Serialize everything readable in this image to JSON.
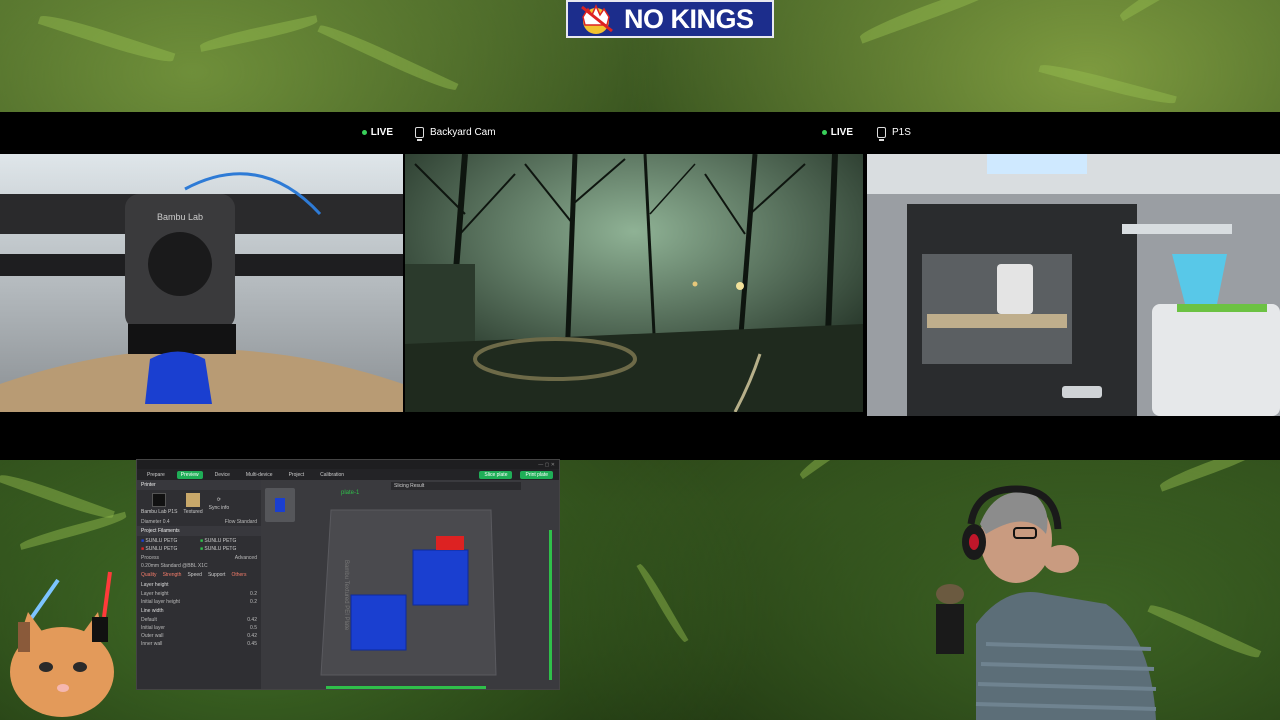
{
  "banner": {
    "text": "NO KINGS"
  },
  "cameras": [
    {
      "name": "",
      "live_label": "LIVE"
    },
    {
      "name": "Backyard Cam",
      "live_label": "LIVE"
    },
    {
      "name": "P1S",
      "live_label": ""
    }
  ],
  "printer_cam": {
    "logo": "Bambu Lab"
  },
  "slicer": {
    "tabs": [
      "Prepare",
      "Preview",
      "Device",
      "Multi-device",
      "Project",
      "Calibration"
    ],
    "active_tab": "Preview",
    "slice_label": "Slice plate",
    "print_label": "Print plate",
    "printer_section": "Printer",
    "printer_name": "Bambu Lab P1S",
    "plate_type": "Textured",
    "sync_label": "Sync info",
    "diameter_label": "Diameter",
    "diameter_value": "0.4",
    "flow_label": "Flow",
    "flow_value": "Standard",
    "filaments_section": "Project Filaments",
    "filaments": [
      "SUNLU PETG",
      "SUNLU PETG",
      "SUNLU PETG",
      "SUNLU PETG"
    ],
    "process_label": "Process",
    "process_value": "0.20mm Standard @BBL X1C",
    "advanced_label": "Advanced",
    "quality_tabs": [
      "Quality",
      "Strength",
      "Speed",
      "Support",
      "Others"
    ],
    "layer_height_section": "Layer height",
    "layer_rows": [
      {
        "label": "Layer height",
        "value": "0.2"
      },
      {
        "label": "Initial layer height",
        "value": "0.2"
      }
    ],
    "line_width_section": "Line width",
    "line_rows": [
      {
        "label": "Default",
        "value": "0.42"
      },
      {
        "label": "Initial layer",
        "value": "0.5"
      },
      {
        "label": "Outer wall",
        "value": "0.42"
      },
      {
        "label": "Inner wall",
        "value": "0.45"
      }
    ],
    "plate_label": "plate-1",
    "slicing_result": "Slicing Result",
    "plate_text": "Bambu Textured PEI Plate"
  },
  "colors": {
    "banner_bg": "#1c2d8c",
    "accent": "#1fae57",
    "live": "#39d05a",
    "model_blue": "#1a3fd0"
  }
}
